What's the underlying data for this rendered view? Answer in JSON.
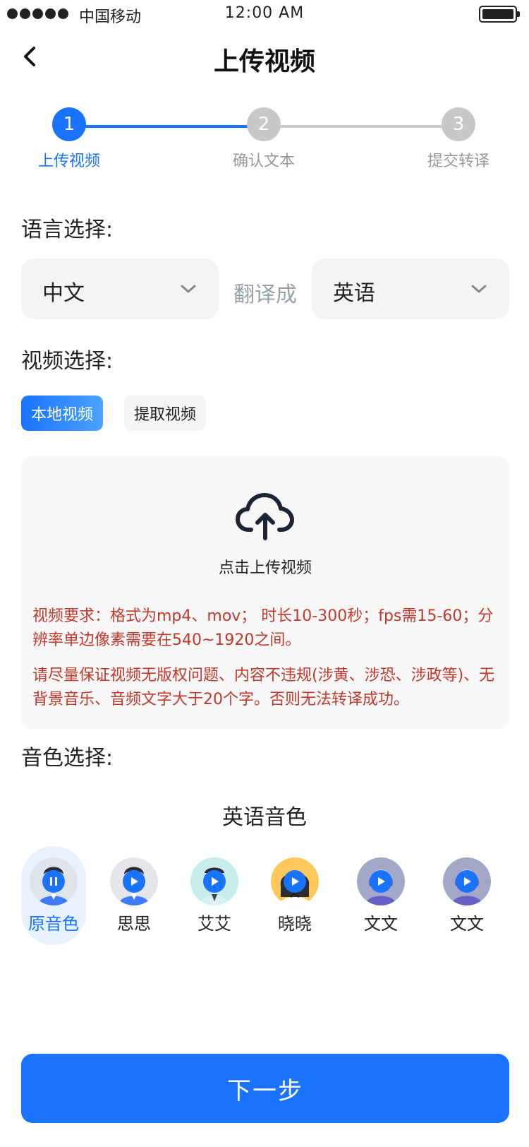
{
  "status_bar": {
    "carrier": "中国移动",
    "time": "12:00 AM"
  },
  "nav": {
    "title": "上传视频"
  },
  "steps": [
    {
      "number": "1",
      "label": "上传视频"
    },
    {
      "number": "2",
      "label": "确认文本"
    },
    {
      "number": "3",
      "label": "提交转译"
    }
  ],
  "language": {
    "label": "语言选择:",
    "from": "中文",
    "translate_to": "翻译成",
    "to": "英语"
  },
  "video": {
    "label": "视频选择:",
    "tabs": [
      "本地视频",
      "提取视频"
    ],
    "upload_text": "点击上传视频",
    "requirement_1": "视频要求：格式为mp4、mov； 时长10-300秒；fps需15-60；分辨率单边像素需要在540~1920之间。",
    "requirement_2": "请尽量保证视频无版权问题、内容不违规(涉黄、涉恐、涉政等)、无背景音乐、音频文字大于20个字。否则无法转译成功。"
  },
  "voice": {
    "label": "音色选择:",
    "language": "英语音色",
    "items": [
      {
        "name": "原音色"
      },
      {
        "name": "思思"
      },
      {
        "name": "艾艾"
      },
      {
        "name": "晓晓"
      },
      {
        "name": "文文"
      },
      {
        "name": "文文"
      }
    ]
  },
  "next_button": "下一步",
  "colors": {
    "primary": "#1a73ff",
    "warning": "#c0392b",
    "muted": "#c8c8c8"
  }
}
